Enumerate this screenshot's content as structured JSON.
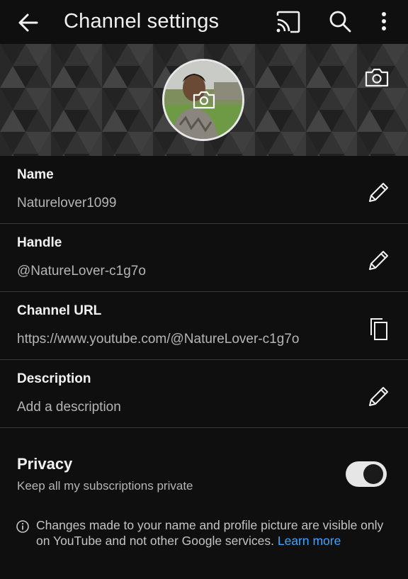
{
  "appbar": {
    "title": "Channel settings",
    "icons": [
      "back-arrow-icon",
      "cast-icon",
      "search-icon",
      "more-vert-icon"
    ]
  },
  "banner": {
    "icons": [
      "banner-camera-icon",
      "avatar-camera-icon"
    ]
  },
  "fields": [
    {
      "label": "Name",
      "value": "Naturelover1099",
      "action_icon": "edit-pencil-icon"
    },
    {
      "label": "Handle",
      "value": "@NatureLover-c1g7o",
      "action_icon": "edit-pencil-icon"
    },
    {
      "label": "Channel URL",
      "value": "https://www.youtube.com/@NatureLover-c1g7o",
      "action_icon": "copy-icon"
    },
    {
      "label": "Description",
      "value": "Add a description",
      "action_icon": "edit-pencil-icon"
    }
  ],
  "privacy": {
    "title": "Privacy",
    "subtitle": "Keep all my subscriptions private",
    "toggle_on": true
  },
  "info": {
    "text": "Changes made to your name and profile picture are visible only on YouTube and not other Google services.",
    "link": "Learn more"
  },
  "colors": {
    "background": "#0f0f0f",
    "link": "#3ea6ff",
    "divider": "#3a3a3a"
  }
}
